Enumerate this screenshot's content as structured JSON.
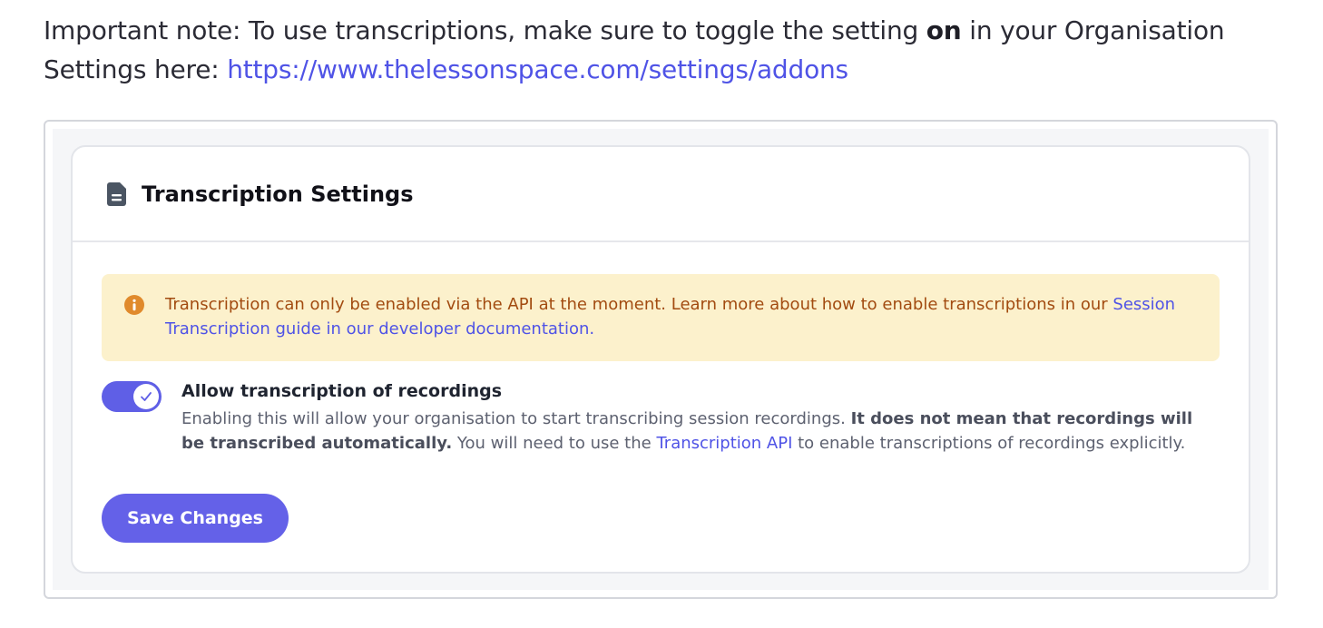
{
  "note": {
    "prefix": "Important note: To use transcriptions, make sure to toggle the setting ",
    "bold": "on",
    "middle": " in your Organisation Settings here: ",
    "link": "https://www.thelessonspace.com/settings/addons"
  },
  "card": {
    "icon": "document-icon",
    "title": "Transcription Settings"
  },
  "alert": {
    "icon": "info-icon",
    "text": "Transcription can only be enabled via the API at the moment. Learn more about how to enable transcriptions in our ",
    "link": "Session Transcription guide in our developer documentation."
  },
  "setting": {
    "toggle_state": "on",
    "label": "Allow transcription of recordings",
    "desc_prefix": "Enabling this will allow your organisation to start transcribing session recordings. ",
    "desc_bold": "It does not mean that recordings will be transcribed automatically.",
    "desc_middle": " You will need to use the ",
    "desc_link": "Transcription API",
    "desc_suffix": " to enable transcriptions of recordings explicitly."
  },
  "save_button": "Save Changes",
  "colors": {
    "accent": "#6461e8",
    "link": "#4f53e6",
    "alert_bg": "#fcf1cc",
    "alert_text": "#a24b10",
    "alert_icon": "#e08a2c"
  }
}
